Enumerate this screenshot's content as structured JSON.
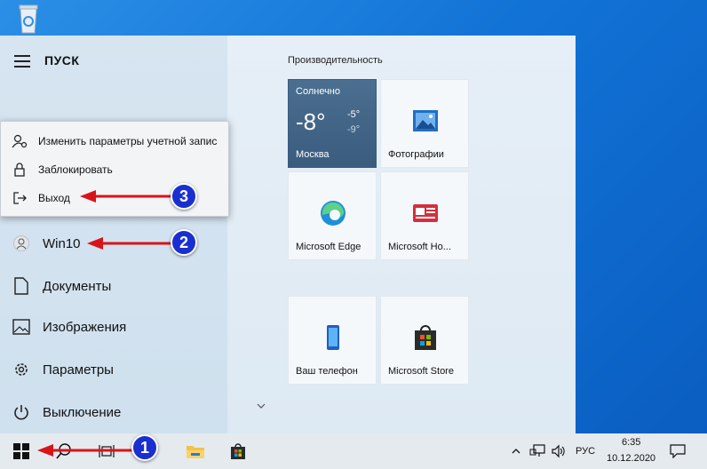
{
  "desktop": {
    "recycle_icon": "recycle-bin-icon"
  },
  "start_menu": {
    "title": "ПУСК",
    "rail": [
      {
        "label": "Win10",
        "icon": "user-avatar-icon"
      },
      {
        "label": "Документы",
        "icon": "document-icon"
      },
      {
        "label": "Изображения",
        "icon": "pictures-icon"
      },
      {
        "label": "Параметры",
        "icon": "gear-icon"
      },
      {
        "label": "Выключение",
        "icon": "power-icon"
      }
    ],
    "account_popup": {
      "items": [
        {
          "label": "Изменить параметры учетной запис",
          "icon": "account-settings-icon"
        },
        {
          "label": "Заблокировать",
          "icon": "lock-icon"
        },
        {
          "label": "Выход",
          "icon": "sign-out-icon"
        }
      ]
    },
    "group_title": "Производительность",
    "weather": {
      "title": "Солнечно",
      "temp": "-8°",
      "high": "-5°",
      "low": "-9°",
      "city": "Москва"
    },
    "tiles": [
      {
        "label": "Фотографии",
        "icon": "photos-icon"
      },
      {
        "label": "Microsoft Edge",
        "icon": "edge-icon"
      },
      {
        "label": "Microsoft Ho...",
        "icon": "news-icon"
      },
      {
        "label": "Ваш телефон",
        "icon": "phone-icon"
      },
      {
        "label": "Microsoft Store",
        "icon": "store-icon"
      }
    ]
  },
  "taskbar": {
    "lang": "РУС",
    "time": "6:35",
    "date": "10.12.2020"
  },
  "annotations": {
    "b1": "1",
    "b2": "2",
    "b3": "3"
  }
}
